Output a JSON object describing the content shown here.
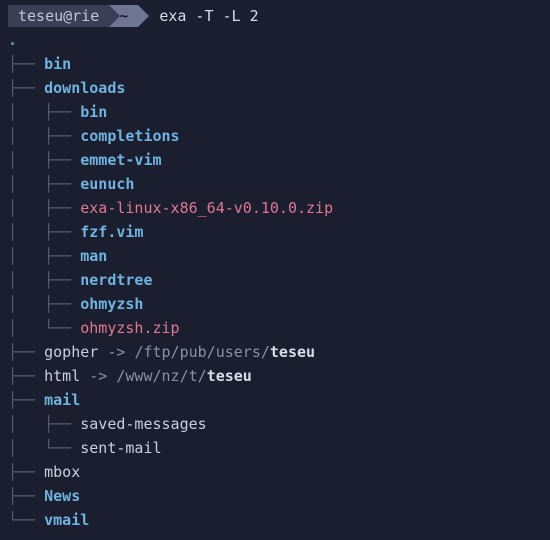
{
  "prompt": {
    "userhost": "teseu@rie",
    "dir": "~",
    "command": "exa -T -L 2"
  },
  "root": ".",
  "entries": [
    {
      "branch": "├── ",
      "name": "bin",
      "cls": "dir-col"
    },
    {
      "branch": "├── ",
      "name": "downloads",
      "cls": "dir-col"
    },
    {
      "branch": "│   ├── ",
      "name": "bin",
      "cls": "dir-col"
    },
    {
      "branch": "│   ├── ",
      "name": "completions",
      "cls": "dir-col"
    },
    {
      "branch": "│   ├── ",
      "name": "emmet-vim",
      "cls": "dir-col"
    },
    {
      "branch": "│   ├── ",
      "name": "eunuch",
      "cls": "dir-col"
    },
    {
      "branch": "│   ├── ",
      "name": "exa-linux-x86_64-v0.10.0.zip",
      "cls": "file-col"
    },
    {
      "branch": "│   ├── ",
      "name": "fzf.vim",
      "cls": "dir-col"
    },
    {
      "branch": "│   ├── ",
      "name": "man",
      "cls": "dir-col"
    },
    {
      "branch": "│   ├── ",
      "name": "nerdtree",
      "cls": "dir-col"
    },
    {
      "branch": "│   ├── ",
      "name": "ohmyzsh",
      "cls": "dir-col"
    },
    {
      "branch": "│   └── ",
      "name": "ohmyzsh.zip",
      "cls": "file-col"
    },
    {
      "branch": "├── ",
      "name": "gopher",
      "cls": "plain-col",
      "link_path": "/ftp/pub/users/",
      "link_target": "teseu"
    },
    {
      "branch": "├── ",
      "name": "html",
      "cls": "plain-col",
      "link_path": "/www/nz/t/",
      "link_target": "teseu"
    },
    {
      "branch": "├── ",
      "name": "mail",
      "cls": "dir-col"
    },
    {
      "branch": "│   ├── ",
      "name": "saved-messages",
      "cls": "plain-col"
    },
    {
      "branch": "│   └── ",
      "name": "sent-mail",
      "cls": "plain-col"
    },
    {
      "branch": "├── ",
      "name": "mbox",
      "cls": "plain-col"
    },
    {
      "branch": "├── ",
      "name": "News",
      "cls": "dir-col"
    },
    {
      "branch": "└── ",
      "name": "vmail",
      "cls": "dir-col"
    }
  ],
  "arrow": " -> "
}
